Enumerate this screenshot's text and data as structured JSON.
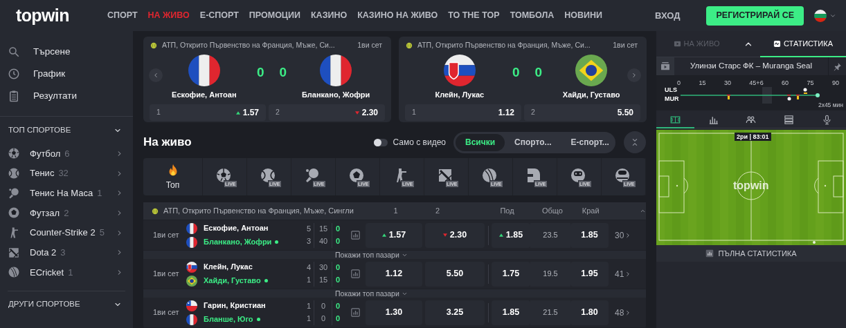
{
  "header": {
    "logo": "topwin",
    "nav": [
      {
        "label": "СПОРТ",
        "selected": false
      },
      {
        "label": "НА ЖИВО",
        "selected": true
      },
      {
        "label": "Е-СПОРТ",
        "selected": false
      },
      {
        "label": "ПРОМОЦИИ",
        "selected": false
      },
      {
        "label": "КАЗИНО",
        "selected": false
      },
      {
        "label": "КАЗИНО НА ЖИВО",
        "selected": false
      },
      {
        "label": "ТО THE TOP",
        "selected": false
      },
      {
        "label": "ТОМБОЛА",
        "selected": false
      },
      {
        "label": "НОВИНИ",
        "selected": false
      }
    ],
    "login": "ВХОД",
    "register": "РЕГИСТРИРАЙ СЕ"
  },
  "sidebar": {
    "links": [
      "Търсене",
      "График",
      "Резултати"
    ],
    "top_sports": {
      "title": "ТОП СПОРТОВЕ",
      "items": [
        {
          "name": "Футбол",
          "count": "6"
        },
        {
          "name": "Тенис",
          "count": "32"
        },
        {
          "name": "Тенис На Маса",
          "count": "1"
        },
        {
          "name": "Футзал",
          "count": "2"
        },
        {
          "name": "Counter-Strike 2",
          "count": "5"
        },
        {
          "name": "Dota 2",
          "count": "3"
        },
        {
          "name": "ECricket",
          "count": "1"
        }
      ]
    },
    "other_sports": {
      "title": "ДРУГИ СПОРТОВЕ"
    }
  },
  "featured": [
    {
      "league": "АТП, Открито Първенство на Франция, Мъже, Си...",
      "period": "1ви сет",
      "home": {
        "name": "Ескофие, Антоан",
        "kind": "fr",
        "score": "0"
      },
      "away": {
        "name": "Бланкано, Жофри",
        "kind": "fr",
        "score": "0"
      },
      "odds": [
        {
          "label": "1",
          "value": "1.57",
          "kind": "up"
        },
        {
          "label": "2",
          "value": "2.30",
          "kind": "down"
        }
      ]
    },
    {
      "league": "АТП, Открито Първенство на Франция, Мъже, Си...",
      "period": "1ви сет",
      "home": {
        "name": "Клейн, Лукас",
        "kind": "sk",
        "score": "0"
      },
      "away": {
        "name": "Хайди, Густаво",
        "kind": "br",
        "score": "0"
      },
      "odds": [
        {
          "label": "1",
          "value": "1.12"
        },
        {
          "label": "2",
          "value": "5.50"
        }
      ]
    }
  ],
  "live": {
    "title": "На живо",
    "video_toggle": {
      "label": "Само с видео",
      "on": false
    },
    "segments": [
      {
        "label": "Всички",
        "selected": true
      },
      {
        "label": "Спорто...",
        "selected": false
      },
      {
        "label": "Е-спорт...",
        "selected": false
      }
    ],
    "filters": [
      {
        "label": "Топ"
      },
      {
        "badge": "LIVE"
      },
      {
        "badge": "LIVE"
      },
      {
        "badge": "LIVE"
      },
      {
        "badge": "LIVE"
      },
      {
        "badge": "LIVE"
      },
      {
        "badge": "LIVE"
      },
      {
        "badge": "LIVE"
      },
      {
        "badge": "LIVE"
      },
      {
        "badge": "LIVE"
      },
      {
        "badge": "LIVE"
      }
    ],
    "table": {
      "league": "АТП, Открито Първенство на Франция, Мъже, Сингли",
      "columns": [
        "1",
        "2",
        "Под",
        "Общо",
        "Край"
      ],
      "rows": [
        {
          "period": "1ви сет",
          "home": {
            "name": "Ескофие, Антоан",
            "kind": "fr",
            "games": "5",
            "points": "15",
            "sets": "0",
            "serving": false
          },
          "away": {
            "name": "Бланкано, Жофри",
            "kind": "fr",
            "games": "3",
            "points": "40",
            "sets": "0",
            "serving": true
          },
          "odds": [
            {
              "value": "1.57",
              "kind": "up"
            },
            {
              "value": "2.30",
              "kind": "down"
            }
          ],
          "under": {
            "value": "1.85",
            "kind": "up"
          },
          "total": "23.5",
          "over": {
            "value": "1.85"
          },
          "more": "30",
          "show_markets": "Покажи топ пазари"
        },
        {
          "period": "1ви сет",
          "home": {
            "name": "Клейн, Лукас",
            "kind": "sk",
            "games": "4",
            "points": "30",
            "sets": "0",
            "serving": false
          },
          "away": {
            "name": "Хайди, Густаво",
            "kind": "br",
            "games": "1",
            "points": "15",
            "sets": "0",
            "serving": true
          },
          "odds": [
            {
              "value": "1.12"
            },
            {
              "value": "5.50"
            }
          ],
          "under": {
            "value": "1.75"
          },
          "total": "19.5",
          "over": {
            "value": "1.95"
          },
          "more": "41",
          "show_markets": "Покажи топ пазари"
        },
        {
          "period": "1ви сет",
          "home": {
            "name": "Гарин, Кристиан",
            "kind": "cl",
            "games": "1",
            "points": "0",
            "sets": "0",
            "serving": false
          },
          "away": {
            "name": "Бланше, Юго",
            "kind": "fr",
            "games": "1",
            "points": "0",
            "sets": "0",
            "serving": true
          },
          "odds": [
            {
              "value": "1.30"
            },
            {
              "value": "3.25"
            }
          ],
          "under": {
            "value": "1.85"
          },
          "total": "21.5",
          "over": {
            "value": "1.80"
          },
          "more": "48"
        }
      ]
    }
  },
  "panel": {
    "tabs": [
      {
        "label": "НА ЖИВО",
        "selected": false,
        "disabled": true
      },
      {
        "label": "СТАТИСТИКА",
        "selected": true,
        "disabled": false
      }
    ],
    "match": "Улинзи Старс ФК – Muranga Seal",
    "timeline": {
      "ticks": [
        "0",
        "15",
        "30",
        "45+6",
        "60",
        "75",
        "90"
      ],
      "teams": [
        "ULS",
        "MUR"
      ],
      "duration": "2x45 мин"
    },
    "stat_tabs": [
      {
        "selected": true
      },
      {
        "selected": false
      },
      {
        "selected": false
      },
      {
        "selected": false
      },
      {
        "selected": false
      }
    ],
    "pitch": {
      "clock": "2ри | 83:01",
      "logo": "topwin"
    },
    "full_stats": "ПЪЛНА СТАТИСТИКА"
  }
}
